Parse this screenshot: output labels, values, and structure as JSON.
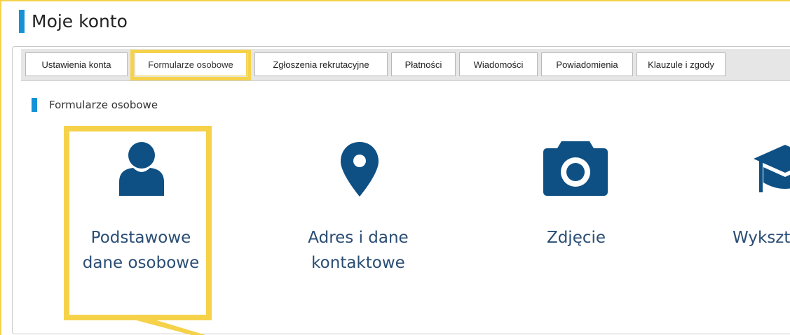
{
  "page": {
    "title": "Moje konto"
  },
  "tabs": [
    {
      "label": "Ustawienia konta",
      "active": false
    },
    {
      "label": "Formularze osobowe",
      "active": true
    },
    {
      "label": "Zgłoszenia rekrutacyjne",
      "active": false
    },
    {
      "label": "Płatności",
      "active": false
    },
    {
      "label": "Wiadomości",
      "active": false
    },
    {
      "label": "Powiadomienia",
      "active": false
    },
    {
      "label": "Klauzule i zgody",
      "active": false
    }
  ],
  "section": {
    "title": "Formularze osobowe"
  },
  "cards": [
    {
      "label": "Podstawowe dane osobowe",
      "icon": "person-icon"
    },
    {
      "label": "Adres i dane kontaktowe",
      "icon": "location-pin-icon"
    },
    {
      "label": "Zdjęcie",
      "icon": "camera-icon"
    },
    {
      "label": "Wykszt",
      "icon": "graduation-cap-icon"
    }
  ],
  "colors": {
    "accent": "#1592d6",
    "icon": "#0e5084",
    "card_text": "#2a4d74",
    "highlight": "#f5d24a"
  }
}
